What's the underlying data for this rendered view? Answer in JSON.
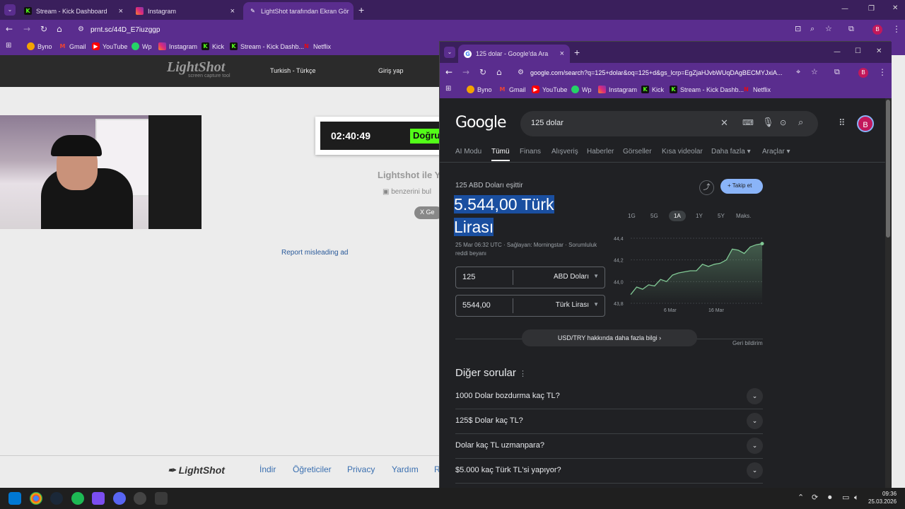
{
  "back_browser": {
    "tabs": [
      {
        "label": "Stream - Kick Dashboard",
        "icon": "kick-icon"
      },
      {
        "label": "Instagram",
        "icon": "instagram-icon"
      },
      {
        "label": "LightShot tarafından Ekran Gör",
        "icon": "lightshot-icon"
      }
    ],
    "url": "prnt.sc/44D_E7iuzggp",
    "bookmarks": [
      "Byno",
      "Gmail",
      "YouTube",
      "Wp",
      "Instagram",
      "Kick",
      "Stream - Kick Dashb...",
      "Netflix"
    ]
  },
  "lightshot": {
    "logo": "LightShot",
    "logo_sub": "screen capture tool",
    "lang": "Turkish - Türkçe",
    "login": "Giriş yap",
    "timer": "02:40:49",
    "timer_badge": "Doğru",
    "title": "Lightshot ile Y",
    "similar": "benzerini bul",
    "x_btn": "X Ge",
    "report": "Report misleading ad",
    "footer_logo": "LightShot",
    "footer_links": [
      "İndir",
      "Öğreticiler",
      "Privacy",
      "Yardım",
      "R"
    ]
  },
  "front_browser": {
    "tab": "125 dolar - Google'da Ara",
    "url": "google.com/search?q=125+dolar&oq=125+d&gs_lcrp=EgZjaHJvbWUqDAgBECMYJxiA...",
    "bookmarks": [
      "Byno",
      "Gmail",
      "YouTube",
      "Wp",
      "Instagram",
      "Kick",
      "Stream - Kick Dashb...",
      "Netflix"
    ],
    "avatar": "B"
  },
  "google": {
    "logo": "Google",
    "query": "125 dolar",
    "tabs": [
      "AI Modu",
      "Tümü",
      "Finans",
      "Alışveriş",
      "Haberler",
      "Görseller",
      "Kısa videolar",
      "Daha fazla ▾",
      "Araçlar ▾"
    ],
    "equals_label": "125 ABD Doları eşittir",
    "result": "5.544,00 Türk Lirası",
    "follow": "Takip et",
    "source": "25 Mar 06:32 UTC · Sağlayan: Morningstar · Sorumluluk reddi beyanı",
    "from_value": "125",
    "from_currency": "ABD Doları",
    "to_value": "5544,00",
    "to_currency": "Türk Lirası",
    "ranges": [
      "1G",
      "5G",
      "1A",
      "1Y",
      "5Y",
      "Maks."
    ],
    "more_info": "USD/TRY hakkında daha fazla bilgi",
    "feedback": "Geri bildirim",
    "other_questions": "Diğer sorular",
    "questions": [
      "1000 Dolar bozdurma kaç TL?",
      "125$ Dolar kaç TL?",
      "Dolar kaç TL uzmanpara?",
      "$5.000 kaç Türk TL'si yapıyor?"
    ]
  },
  "chart_data": {
    "type": "line",
    "x_ticks": [
      "6 Mar",
      "16 Mar"
    ],
    "y_ticks": [
      "44,4",
      "44,2",
      "44,0",
      "43,8"
    ],
    "ylim": [
      43.8,
      44.4
    ],
    "series": [
      {
        "values": [
          43.88,
          43.95,
          43.93,
          43.97,
          43.96,
          44.02,
          44.0,
          44.06,
          44.08,
          44.09,
          44.1,
          44.1,
          44.16,
          44.14,
          44.16,
          44.17,
          44.2,
          44.3,
          44.29,
          44.26,
          44.32,
          44.34,
          44.35
        ]
      }
    ],
    "color": "#81c995"
  },
  "taskbar": {
    "time": "09:36",
    "date": "25.03.2026"
  }
}
